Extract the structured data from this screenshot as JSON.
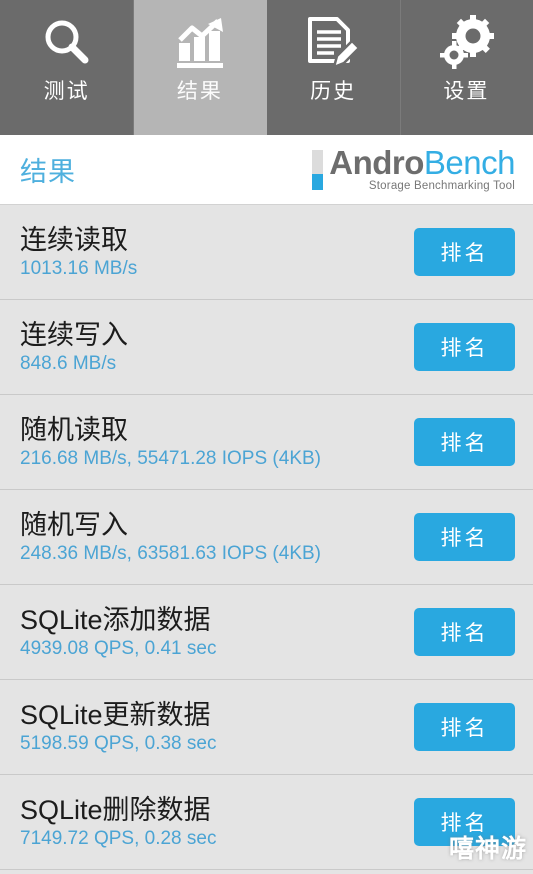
{
  "tabs": [
    {
      "label": "测试",
      "icon": "search-icon",
      "active": false
    },
    {
      "label": "结果",
      "icon": "bar-chart-arrow-icon",
      "active": true
    },
    {
      "label": "历史",
      "icon": "document-pencil-icon",
      "active": false
    },
    {
      "label": "设置",
      "icon": "gears-icon",
      "active": false
    }
  ],
  "header": {
    "page_title": "结果",
    "logo": {
      "word_primary": "Andro",
      "word_secondary": "Bench",
      "subtitle": "Storage Benchmarking Tool"
    }
  },
  "results": {
    "rank_button_label": "排名",
    "rows": [
      {
        "label": "连续读取",
        "value": "1013.16 MB/s"
      },
      {
        "label": "连续写入",
        "value": "848.6 MB/s"
      },
      {
        "label": "随机读取",
        "value": "216.68 MB/s, 55471.28 IOPS (4KB)"
      },
      {
        "label": "随机写入",
        "value": "248.36 MB/s, 63581.63 IOPS (4KB)"
      },
      {
        "label": "SQLite添加数据",
        "value": "4939.08 QPS, 0.41 sec"
      },
      {
        "label": "SQLite更新数据",
        "value": "5198.59 QPS, 0.38 sec"
      },
      {
        "label": "SQLite删除数据",
        "value": "7149.72 QPS, 0.28 sec"
      }
    ]
  },
  "watermark": {
    "text": "嘻神游"
  },
  "colors": {
    "accent_blue": "#29a8e0",
    "value_blue": "#4ba4d4",
    "title_blue": "#4fb0de",
    "tab_inactive_bg": "#6b6b6b",
    "tab_active_bg": "#b5b5b5",
    "row_bg": "#e4e4e4"
  }
}
